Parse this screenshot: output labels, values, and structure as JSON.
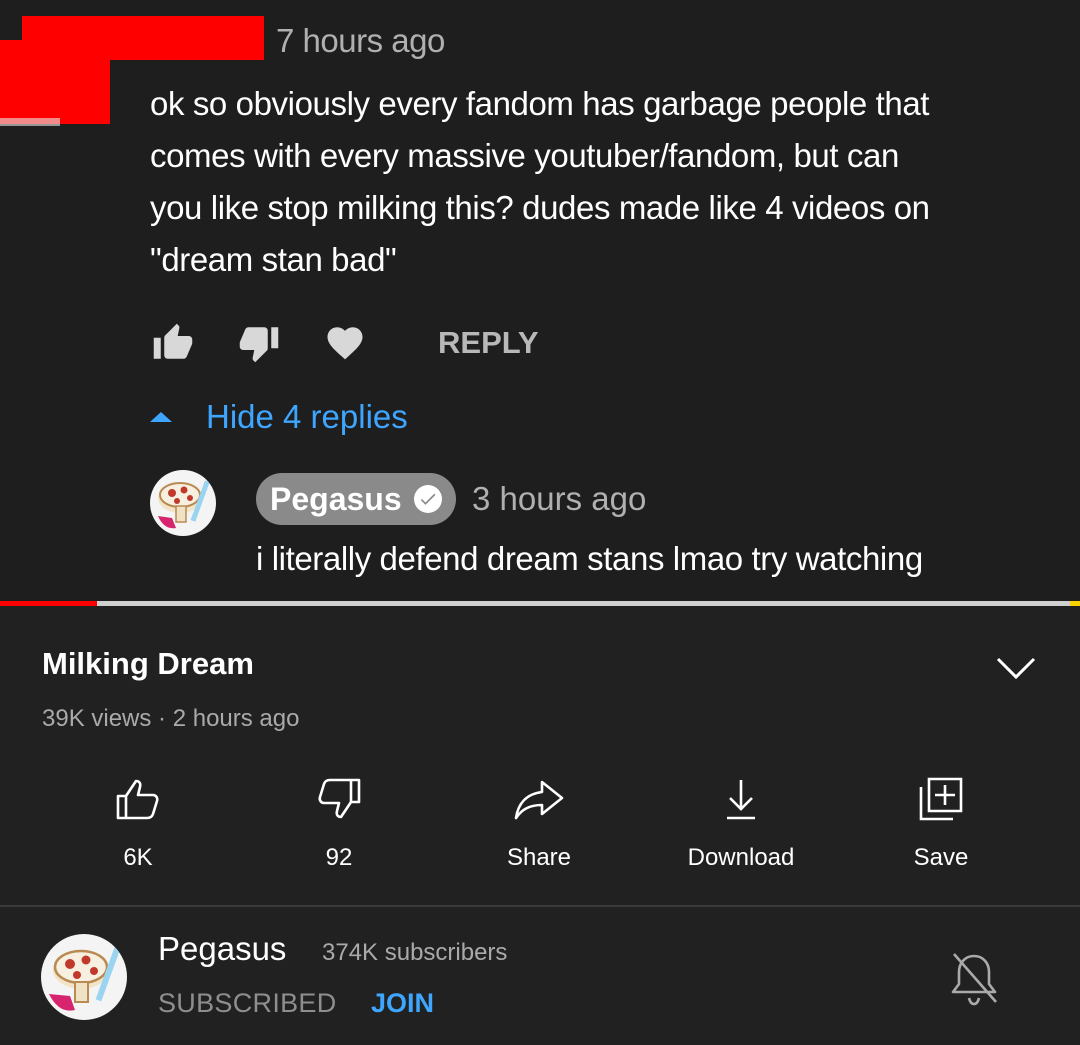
{
  "comment": {
    "time": "7 hours ago",
    "text": "ok so obviously every fandom has garbage people that\ncomes with every massive youtuber/fandom, but can\nyou like stop milking this? dudes made like 4 videos on\n\"dream stan bad\"",
    "actions": {
      "like_icon": "thumbs-up-icon",
      "dislike_icon": "thumbs-down-icon",
      "heart_icon": "heart-icon",
      "reply_label": "REPLY"
    },
    "hide_replies_label": "Hide 4 replies",
    "reply": {
      "author": "Pegasus",
      "time": "3 hours ago",
      "text": "i literally defend dream stans lmao try watching"
    }
  },
  "player": {
    "progress": 0.09,
    "progress_color": "#ff0000"
  },
  "video": {
    "title": "Milking Dream",
    "meta": "39K views · 2 hours ago",
    "actions": [
      {
        "icon": "thumbs-up-outline-icon",
        "label": "6K"
      },
      {
        "icon": "thumbs-down-outline-icon",
        "label": "92"
      },
      {
        "icon": "share-arrow-icon",
        "label": "Share"
      },
      {
        "icon": "download-icon",
        "label": "Download"
      },
      {
        "icon": "save-playlist-icon",
        "label": "Save"
      }
    ]
  },
  "channel": {
    "name": "Pegasus",
    "subscribers": "374K subscribers",
    "subscribed_label": "SUBSCRIBED",
    "join_label": "JOIN",
    "bell_icon": "bell-off-icon"
  },
  "colors": {
    "background": "#212121",
    "accent_blue": "#3ea6ff",
    "muted_text": "#aaaaaa"
  }
}
